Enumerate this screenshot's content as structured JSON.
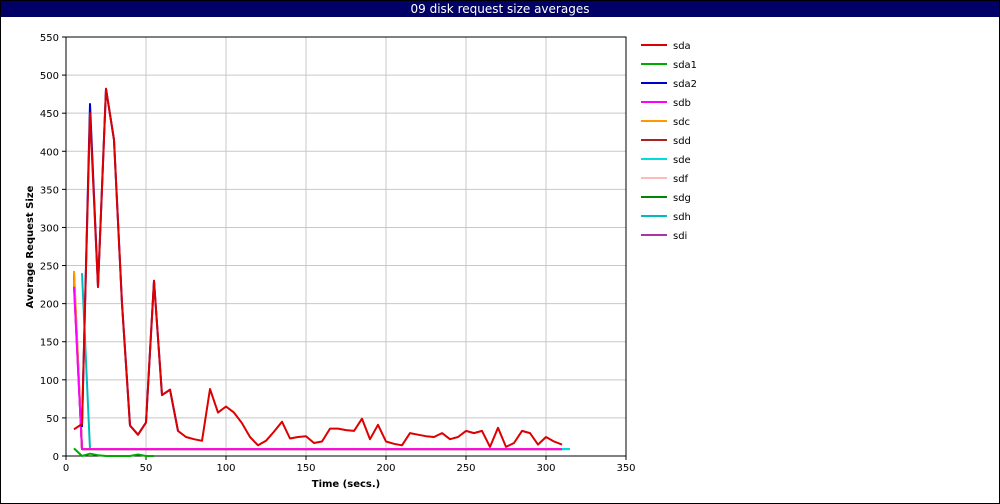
{
  "title": "09 disk request size averages",
  "chart_data": {
    "type": "line",
    "title": "09 disk request size averages",
    "xlabel": "Time (secs.)",
    "ylabel": "Average Request Size",
    "xlim": [
      0,
      350
    ],
    "ylim": [
      0,
      550
    ],
    "xticks": [
      0,
      50,
      100,
      150,
      200,
      250,
      300,
      350
    ],
    "yticks": [
      0,
      50,
      100,
      150,
      200,
      250,
      300,
      350,
      400,
      450,
      500,
      550
    ],
    "grid": true,
    "legend_position": "right",
    "series": [
      {
        "name": "sda",
        "color": "#dd0000",
        "points": [
          [
            5,
            35
          ],
          [
            10,
            42
          ],
          [
            15,
            450
          ],
          [
            20,
            222
          ],
          [
            25,
            482
          ],
          [
            30,
            415
          ],
          [
            35,
            200
          ],
          [
            40,
            40
          ],
          [
            45,
            28
          ],
          [
            50,
            44
          ],
          [
            55,
            230
          ],
          [
            60,
            80
          ],
          [
            65,
            87
          ],
          [
            70,
            33
          ],
          [
            75,
            25
          ],
          [
            80,
            22
          ],
          [
            85,
            20
          ],
          [
            90,
            88
          ],
          [
            95,
            57
          ],
          [
            100,
            65
          ],
          [
            105,
            57
          ],
          [
            110,
            43
          ],
          [
            115,
            25
          ],
          [
            120,
            14
          ],
          [
            125,
            20
          ],
          [
            130,
            32
          ],
          [
            135,
            45
          ],
          [
            140,
            23
          ],
          [
            145,
            25
          ],
          [
            150,
            26
          ],
          [
            155,
            17
          ],
          [
            160,
            19
          ],
          [
            165,
            36
          ],
          [
            170,
            36
          ],
          [
            175,
            34
          ],
          [
            180,
            33
          ],
          [
            185,
            49
          ],
          [
            190,
            22
          ],
          [
            195,
            41
          ],
          [
            200,
            19
          ],
          [
            205,
            16
          ],
          [
            210,
            14
          ],
          [
            215,
            30
          ],
          [
            220,
            28
          ],
          [
            225,
            26
          ],
          [
            230,
            25
          ],
          [
            235,
            30
          ],
          [
            240,
            22
          ],
          [
            245,
            25
          ],
          [
            250,
            33
          ],
          [
            255,
            30
          ],
          [
            260,
            33
          ],
          [
            265,
            12
          ],
          [
            270,
            37
          ],
          [
            275,
            12
          ],
          [
            280,
            17
          ],
          [
            285,
            33
          ],
          [
            290,
            30
          ],
          [
            295,
            15
          ],
          [
            300,
            25
          ],
          [
            305,
            19
          ],
          [
            310,
            15
          ]
        ]
      },
      {
        "name": "sda1",
        "color": "#00aa00",
        "points": [
          [
            5,
            10
          ],
          [
            10,
            0
          ],
          [
            15,
            3
          ],
          [
            20,
            1
          ],
          [
            25,
            0
          ],
          [
            30,
            0
          ],
          [
            35,
            0
          ],
          [
            40,
            0
          ],
          [
            45,
            2
          ],
          [
            50,
            0
          ],
          [
            55,
            0
          ]
        ]
      },
      {
        "name": "sda2",
        "color": "#0000cc",
        "points": [
          [
            10,
            38
          ],
          [
            15,
            462
          ],
          [
            20,
            222
          ],
          [
            25,
            482
          ],
          [
            30,
            415
          ],
          [
            35,
            200
          ],
          [
            40,
            40
          ],
          [
            45,
            28
          ],
          [
            50,
            44
          ],
          [
            55,
            230
          ],
          [
            60,
            80
          ],
          [
            65,
            87
          ],
          [
            70,
            33
          ]
        ]
      },
      {
        "name": "sdb",
        "color": "#ff00ff",
        "points": [
          [
            5,
            222
          ],
          [
            10,
            9
          ],
          [
            15,
            9
          ],
          [
            50,
            9
          ],
          [
            100,
            9
          ],
          [
            150,
            9
          ],
          [
            200,
            9
          ],
          [
            250,
            9
          ],
          [
            300,
            9
          ],
          [
            310,
            9
          ]
        ]
      },
      {
        "name": "sdc",
        "color": "#ff9900",
        "points": [
          [
            5,
            243
          ],
          [
            10,
            9
          ],
          [
            15,
            9
          ],
          [
            50,
            9
          ],
          [
            100,
            9
          ],
          [
            200,
            9
          ],
          [
            300,
            9
          ],
          [
            310,
            9
          ]
        ]
      },
      {
        "name": "sdd",
        "color": "#aa2222",
        "points": [
          [
            5,
            240
          ],
          [
            10,
            9
          ],
          [
            15,
            9
          ],
          [
            50,
            9
          ],
          [
            100,
            9
          ],
          [
            200,
            9
          ],
          [
            300,
            9
          ],
          [
            310,
            9
          ]
        ]
      },
      {
        "name": "sde",
        "color": "#00dddd",
        "points": [
          [
            5,
            235
          ],
          [
            10,
            9
          ],
          [
            15,
            9
          ],
          [
            50,
            9
          ],
          [
            100,
            9
          ],
          [
            200,
            9
          ],
          [
            300,
            9
          ],
          [
            315,
            9
          ]
        ]
      },
      {
        "name": "sdf",
        "color": "#ffbbbb",
        "points": [
          [
            5,
            230
          ],
          [
            10,
            9
          ],
          [
            15,
            9
          ],
          [
            50,
            9
          ],
          [
            100,
            9
          ],
          [
            200,
            9
          ],
          [
            300,
            9
          ],
          [
            310,
            9
          ]
        ]
      },
      {
        "name": "sdg",
        "color": "#008800",
        "points": [
          [
            5,
            228
          ],
          [
            10,
            9
          ],
          [
            15,
            9
          ],
          [
            50,
            9
          ],
          [
            100,
            9
          ],
          [
            200,
            9
          ],
          [
            300,
            9
          ],
          [
            310,
            9
          ]
        ]
      },
      {
        "name": "sdh",
        "color": "#00bbbb",
        "points": [
          [
            10,
            240
          ],
          [
            15,
            9
          ],
          [
            50,
            9
          ],
          [
            100,
            9
          ],
          [
            200,
            9
          ],
          [
            300,
            9
          ],
          [
            315,
            9
          ]
        ]
      },
      {
        "name": "sdi",
        "color": "#aa33aa",
        "points": [
          [
            5,
            225
          ],
          [
            10,
            9
          ],
          [
            15,
            9
          ],
          [
            50,
            9
          ],
          [
            100,
            9
          ],
          [
            200,
            9
          ],
          [
            300,
            9
          ],
          [
            310,
            9
          ]
        ]
      }
    ]
  }
}
